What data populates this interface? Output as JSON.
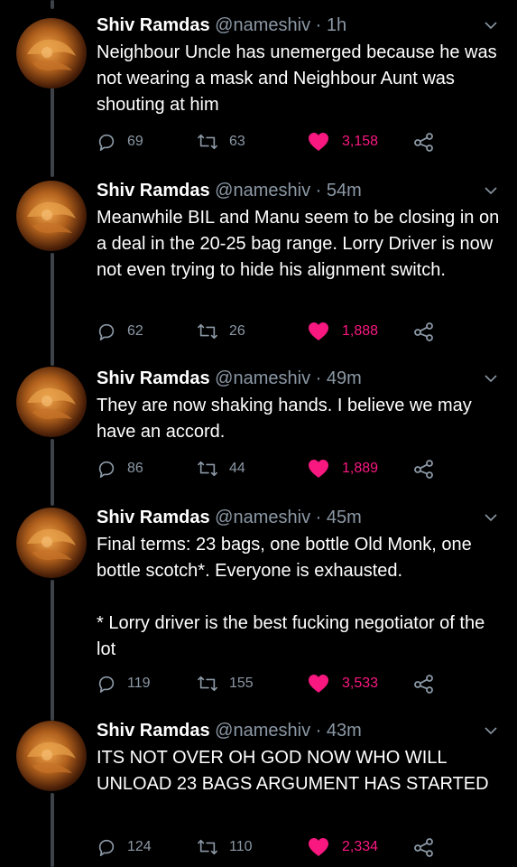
{
  "colors": {
    "background": "#000000",
    "text": "#ffffff",
    "secondary": "#8b98a5",
    "like": "#f91880",
    "thread_line": "#3d4248"
  },
  "icons": {
    "reply": "reply-icon",
    "retweet": "retweet-icon",
    "like": "heart-icon",
    "share": "share-icon",
    "menu": "chevron-down-icon"
  },
  "tweets": [
    {
      "name": "Shiv Ramdas",
      "handle": "@nameshiv",
      "separator": "·",
      "time": "1h",
      "text": "Neighbour Uncle has unemerged because he was not wearing a mask and Neighbour Aunt was shouting at him",
      "replies": "69",
      "retweets": "63",
      "likes": "3,158"
    },
    {
      "name": "Shiv Ramdas",
      "handle": "@nameshiv",
      "separator": "·",
      "time": "54m",
      "text": "Meanwhile BIL and Manu seem to be closing in on a deal in the 20-25 bag range. Lorry Driver is now not even trying to hide his alignment switch.",
      "replies": "62",
      "retweets": "26",
      "likes": "1,888"
    },
    {
      "name": "Shiv Ramdas",
      "handle": "@nameshiv",
      "separator": "·",
      "time": "49m",
      "text": "They are now shaking hands. I believe we may have an accord.",
      "replies": "86",
      "retweets": "44",
      "likes": "1,889"
    },
    {
      "name": "Shiv Ramdas",
      "handle": "@nameshiv",
      "separator": "·",
      "time": "45m",
      "text": "Final terms: 23 bags, one bottle Old Monk, one bottle scotch*. Everyone is exhausted.\n\n* Lorry driver is the best fucking negotiator of the lot",
      "replies": "119",
      "retweets": "155",
      "likes": "3,533"
    },
    {
      "name": "Shiv Ramdas",
      "handle": "@nameshiv",
      "separator": "·",
      "time": "43m",
      "text": "ITS NOT OVER OH GOD NOW WHO WILL UNLOAD 23 BAGS ARGUMENT HAS STARTED",
      "replies": "124",
      "retweets": "110",
      "likes": "2,334"
    }
  ]
}
